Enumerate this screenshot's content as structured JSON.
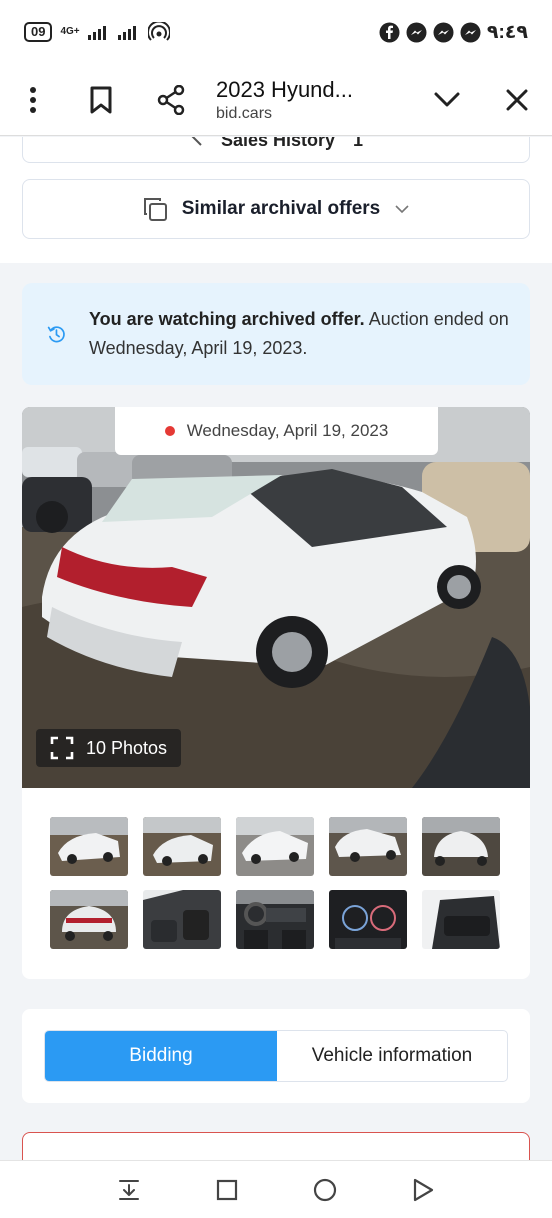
{
  "status_bar": {
    "battery": "09",
    "network": "4G+",
    "time": "٩:٤٩"
  },
  "toolbar": {
    "title": "2023 Hyund...",
    "domain": "bid.cars"
  },
  "sales_history": {
    "label": "Sales History",
    "count": "1"
  },
  "similar_offers": {
    "label": "Similar archival offers"
  },
  "archived_notice": {
    "bold_text": "You are watching archived offer.",
    "text": " Auction ended on Wednesday, April 19, 2023."
  },
  "gallery": {
    "date": "Wednesday, April 19, 2023",
    "photos_label": "10 Photos"
  },
  "tabs": {
    "bidding": "Bidding",
    "vehicle_info": "Vehicle information"
  },
  "colors": {
    "accent": "#2b9af3",
    "notice_bg": "#e6f3fd",
    "alert_border": "#d9534f"
  }
}
